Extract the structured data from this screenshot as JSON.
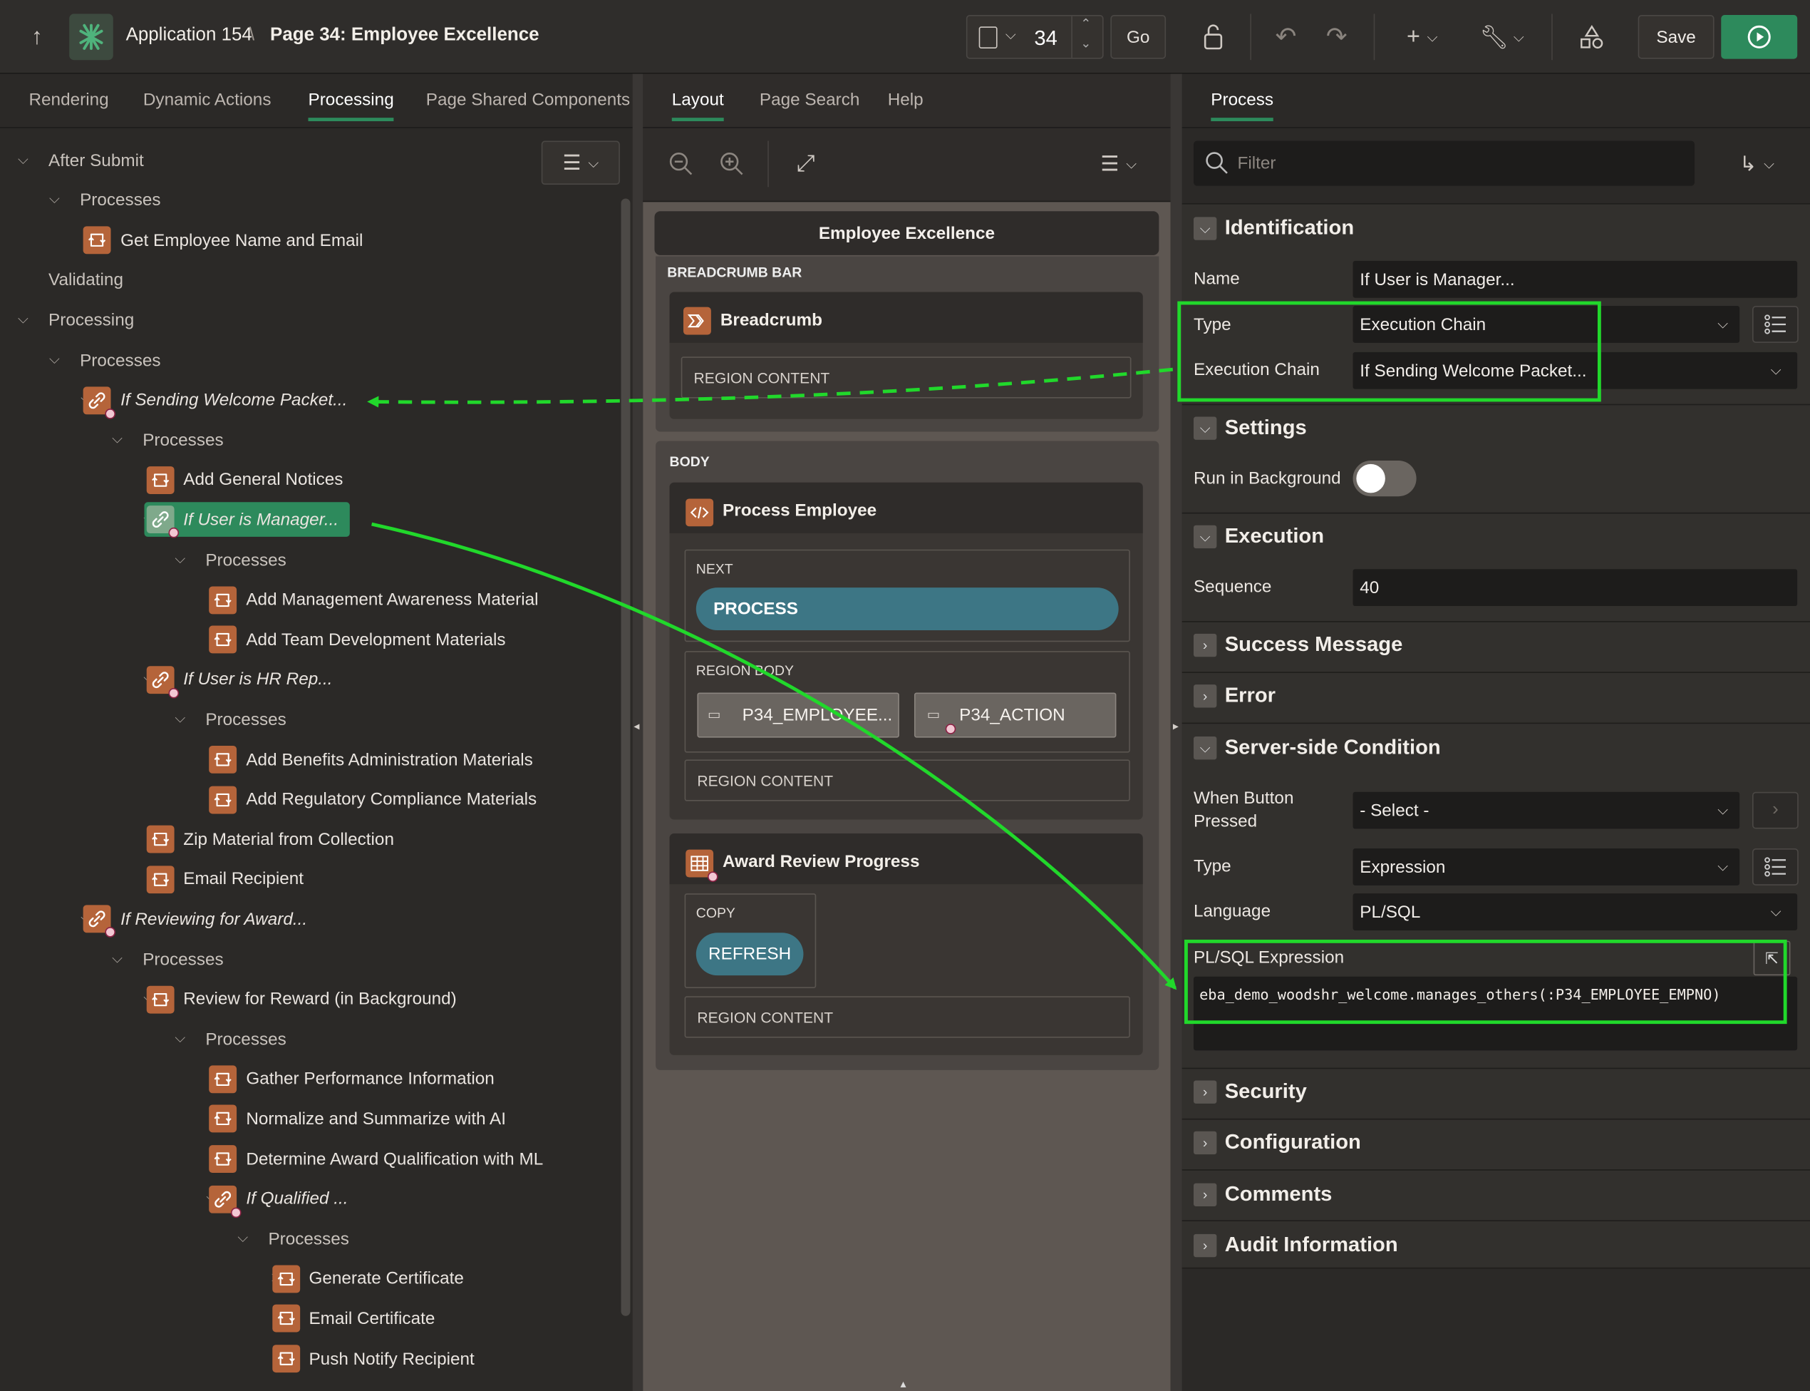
{
  "header": {
    "app_name": "Application 154",
    "separator": "\\",
    "page_title": "Page 34: Employee Excellence",
    "page_number": "34",
    "go_label": "Go",
    "save_label": "Save"
  },
  "left_tabs": [
    "Rendering",
    "Dynamic Actions",
    "Processing",
    "Page Shared Components"
  ],
  "left_active_tab": "Processing",
  "middle_tabs": [
    "Layout",
    "Page Search",
    "Help"
  ],
  "middle_active_tab": "Layout",
  "right_tab": "Process",
  "tree": [
    {
      "label": "After Submit",
      "level": 0,
      "chevron": "down",
      "icon": "none",
      "italic": false
    },
    {
      "label": "Processes",
      "level": 1,
      "chevron": "down",
      "icon": "none",
      "italic": false
    },
    {
      "label": "Get Employee Name and Email",
      "level": 2,
      "chevron": "none",
      "icon": "process-icon",
      "italic": false
    },
    {
      "label": "Validating",
      "level": 0,
      "chevron": "none",
      "icon": "none",
      "italic": false
    },
    {
      "label": "Processing",
      "level": 0,
      "chevron": "down",
      "icon": "none",
      "italic": false
    },
    {
      "label": "Processes",
      "level": 1,
      "chevron": "down",
      "icon": "none",
      "italic": false
    },
    {
      "label": "If Sending Welcome Packet...",
      "level": 2,
      "chevron": "down",
      "icon": "chain-icon",
      "italic": true
    },
    {
      "label": "Processes",
      "level": 3,
      "chevron": "down",
      "icon": "none",
      "italic": false
    },
    {
      "label": "Add General Notices",
      "level": 4,
      "chevron": "none",
      "icon": "process-icon",
      "italic": false
    },
    {
      "label": "If User is Manager...",
      "level": 4,
      "chevron": "down",
      "icon": "chain-icon",
      "italic": true,
      "selected": true
    },
    {
      "label": "Processes",
      "level": 5,
      "chevron": "down",
      "icon": "none",
      "italic": false
    },
    {
      "label": "Add Management Awareness Material",
      "level": 6,
      "chevron": "none",
      "icon": "process-icon",
      "italic": false
    },
    {
      "label": "Add Team Development Materials",
      "level": 6,
      "chevron": "none",
      "icon": "process-icon",
      "italic": false
    },
    {
      "label": "If User is HR Rep...",
      "level": 4,
      "chevron": "down",
      "icon": "chain-icon",
      "italic": true
    },
    {
      "label": "Processes",
      "level": 5,
      "chevron": "down",
      "icon": "none",
      "italic": false
    },
    {
      "label": "Add Benefits Administration Materials",
      "level": 6,
      "chevron": "none",
      "icon": "process-icon",
      "italic": false
    },
    {
      "label": "Add Regulatory Compliance Materials",
      "level": 6,
      "chevron": "none",
      "icon": "process-icon",
      "italic": false
    },
    {
      "label": "Zip Material from Collection",
      "level": 4,
      "chevron": "none",
      "icon": "process-icon",
      "italic": false
    },
    {
      "label": "Email Recipient",
      "level": 4,
      "chevron": "none",
      "icon": "process-icon",
      "italic": false
    },
    {
      "label": "If Reviewing for Award...",
      "level": 2,
      "chevron": "down",
      "icon": "chain-icon",
      "italic": true
    },
    {
      "label": "Processes",
      "level": 3,
      "chevron": "down",
      "icon": "none",
      "italic": false
    },
    {
      "label": "Review for Reward (in Background)",
      "level": 4,
      "chevron": "down",
      "icon": "process-icon",
      "italic": false
    },
    {
      "label": "Processes",
      "level": 5,
      "chevron": "down",
      "icon": "none",
      "italic": false
    },
    {
      "label": "Gather Performance Information",
      "level": 6,
      "chevron": "right",
      "icon": "process-icon",
      "italic": false
    },
    {
      "label": "Normalize and Summarize with AI",
      "level": 6,
      "chevron": "right",
      "icon": "process-icon",
      "italic": false
    },
    {
      "label": "Determine Award Qualification with ML",
      "level": 6,
      "chevron": "right",
      "icon": "process-icon",
      "italic": false
    },
    {
      "label": "If Qualified ...",
      "level": 6,
      "chevron": "down",
      "icon": "chain-icon",
      "italic": true
    },
    {
      "label": "Processes",
      "level": 7,
      "chevron": "down",
      "icon": "none",
      "italic": false
    },
    {
      "label": "Generate Certificate",
      "level": 8,
      "chevron": "right",
      "icon": "process-icon",
      "italic": false
    },
    {
      "label": "Email Certificate",
      "level": 8,
      "chevron": "none",
      "icon": "process-icon",
      "italic": false
    },
    {
      "label": "Push Notify Recipient",
      "level": 8,
      "chevron": "none",
      "icon": "process-icon",
      "italic": false
    }
  ],
  "layout": {
    "page_title": "Employee Excellence",
    "breadcrumb_bar_label": "BREADCRUMB BAR",
    "breadcrumb_region": "Breadcrumb",
    "region_content": "REGION CONTENT",
    "body_label": "BODY",
    "process_employee_region": "Process Employee",
    "next_label": "NEXT",
    "process_button": "PROCESS",
    "region_body_label": "REGION BODY",
    "item1": "P34_EMPLOYEE...",
    "item2": "P34_ACTION",
    "award_region": "Award Review Progress",
    "copy_label": "COPY",
    "refresh_button": "REFRESH"
  },
  "props": {
    "filter_placeholder": "Filter",
    "identification": "Identification",
    "name_label": "Name",
    "name_value": "If User is Manager...",
    "type_label": "Type",
    "type_value": "Execution Chain",
    "chain_label": "Execution Chain",
    "chain_value": "If Sending Welcome Packet...",
    "settings": "Settings",
    "run_bg_label": "Run in Background",
    "execution": "Execution",
    "sequence_label": "Sequence",
    "sequence_value": "40",
    "success_message": "Success Message",
    "error": "Error",
    "server_side": "Server-side Condition",
    "when_button_label_1": "When Button",
    "when_button_label_2": "Pressed",
    "when_button_value": "- Select -",
    "cond_type_label": "Type",
    "cond_type_value": "Expression",
    "language_label": "Language",
    "language_value": "PL/SQL",
    "plsql_label": "PL/SQL Expression",
    "plsql_value": "eba_demo_woodshr_welcome.manages_others(:P34_EMPLOYEE_EMPNO)",
    "security": "Security",
    "configuration": "Configuration",
    "comments": "Comments",
    "audit": "Audit Information"
  },
  "colors": {
    "accent_green": "#2d8a5c",
    "highlight_green": "#21d82b",
    "process_orange": "#b5643a",
    "button_teal": "#3d7685"
  }
}
